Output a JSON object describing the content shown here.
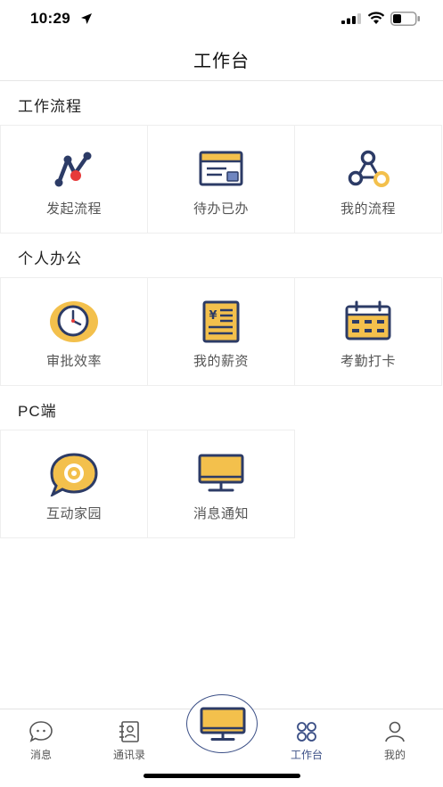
{
  "status_bar": {
    "time": "10:29"
  },
  "nav": {
    "title": "工作台"
  },
  "sections": [
    {
      "title": "工作流程",
      "items": [
        {
          "label": "发起流程",
          "icon": "flow-chart-icon"
        },
        {
          "label": "待办已办",
          "icon": "task-card-icon"
        },
        {
          "label": "我的流程",
          "icon": "process-circles-icon"
        }
      ]
    },
    {
      "title": "个人办公",
      "items": [
        {
          "label": "审批效率",
          "icon": "clock-icon"
        },
        {
          "label": "我的薪资",
          "icon": "salary-document-icon"
        },
        {
          "label": "考勤打卡",
          "icon": "calendar-icon"
        }
      ]
    },
    {
      "title": "PC端",
      "items": [
        {
          "label": "互动家园",
          "icon": "chat-bubble-icon"
        },
        {
          "label": "消息通知",
          "icon": "monitor-icon"
        }
      ]
    }
  ],
  "tabbar": {
    "items": [
      {
        "label": "消息",
        "icon": "message-bubble-icon",
        "active": false
      },
      {
        "label": "通讯录",
        "icon": "contacts-icon",
        "active": false
      },
      {
        "label": "工作台",
        "icon": "workbench-grid-icon",
        "active": true
      },
      {
        "label": "我的",
        "icon": "profile-icon",
        "active": false
      }
    ],
    "center_icon": "monitor-icon"
  },
  "colors": {
    "accent": "#3b4f86",
    "highlight": "#f3c04c",
    "alert": "#e63a3a"
  }
}
